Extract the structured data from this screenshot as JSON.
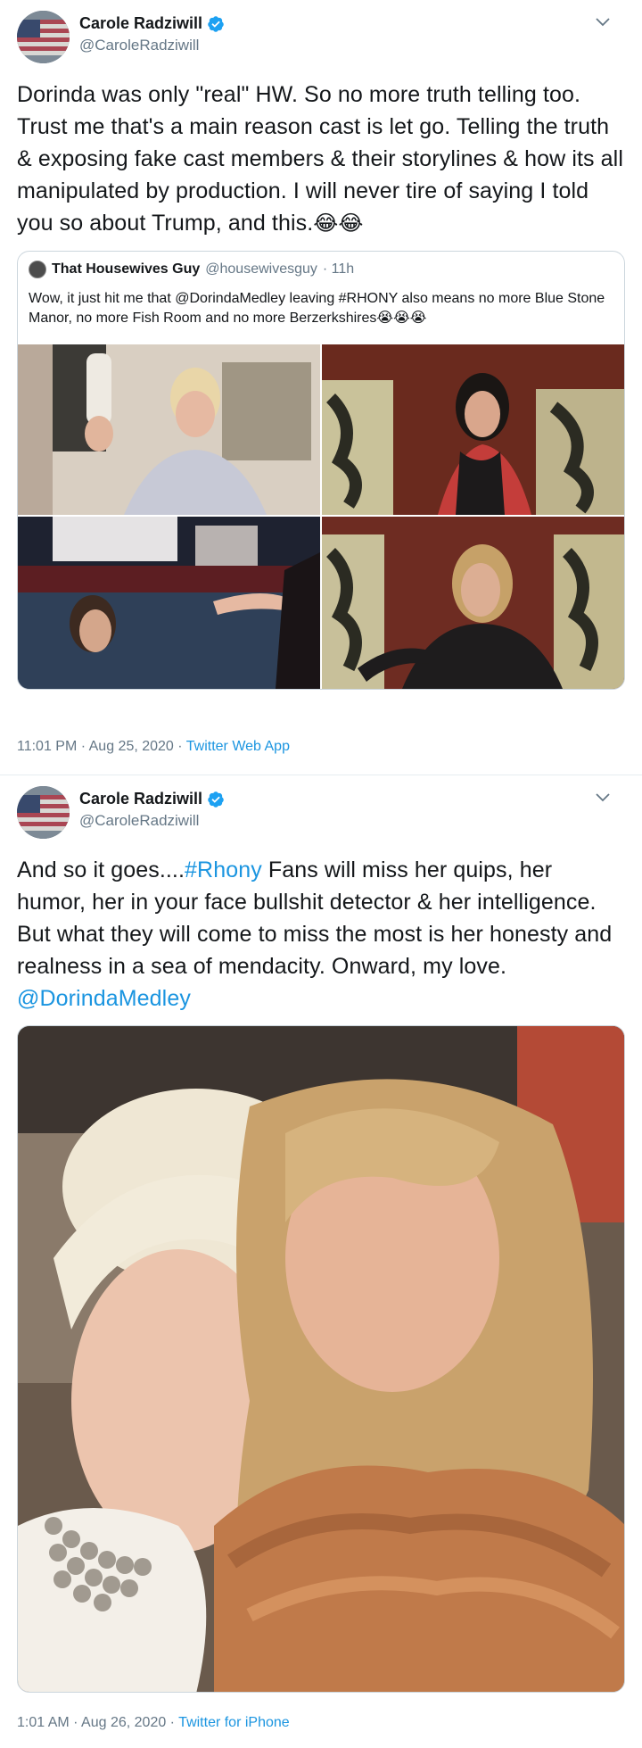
{
  "tweets": [
    {
      "author": {
        "name": "Carole Radziwill",
        "handle": "@CaroleRadziwill",
        "avatar_icon": "american-flag-icon",
        "verified_icon": "verified-badge-icon"
      },
      "text": "Dorinda was only \"real\" HW. So no more truth telling too. Trust me that's a main reason cast is let go. Telling the truth & exposing fake cast members & their storylines & how its all manipulated by production. I will never tire of saying I told you so about Trump, and this.",
      "emoji": "😂😂",
      "quote": {
        "name": "That Housewives Guy",
        "handle": "@housewivesguy",
        "time": "· 11h",
        "text": "Wow, it just hit me that @DorindaMedley leaving #RHONY also means no more Blue Stone Manor, no more Fish Room and no more Berzerkshires",
        "emoji": "😭😭😭"
      },
      "timestamp": "11:01 PM · Aug 25, 2020 · ",
      "source": "Twitter Web App"
    },
    {
      "author": {
        "name": "Carole Radziwill",
        "handle": "@CaroleRadziwill",
        "avatar_icon": "american-flag-icon",
        "verified_icon": "verified-badge-icon"
      },
      "text_prefix": "And so it goes....",
      "hashtag": "#Rhony",
      "text_body": " Fans will miss her quips, her humor, her in your face bullshit detector & her intelligence. But what they will come to miss the most is her honesty and realness in a sea of mendacity. Onward, my love. ",
      "mention": "@DorindaMedley",
      "timestamp": "1:01 AM · Aug 26, 2020 · ",
      "source": "Twitter for iPhone"
    }
  ],
  "colors": {
    "link": "#1b95e0",
    "secondary": "#657786",
    "border": "#ccd6dd",
    "verified": "#1da1f2"
  }
}
